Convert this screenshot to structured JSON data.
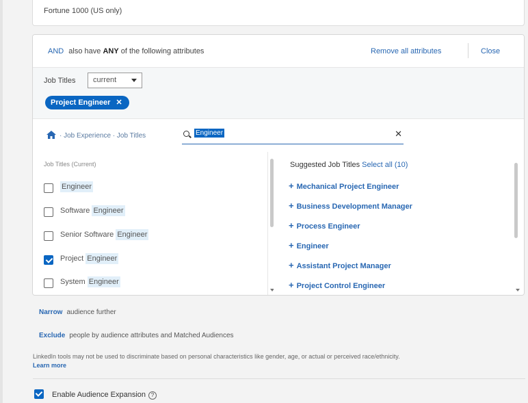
{
  "top_card": {
    "text": "Fortune 1000 (US only)"
  },
  "panel": {
    "and_prefix": "AND",
    "heading_pre": "also have",
    "heading_bold": "ANY",
    "heading_post": "of the following attributes",
    "remove_all": "Remove all attributes",
    "close": "Close",
    "job_titles_label": "Job Titles",
    "select_value": "current",
    "chip_label": "Project Engineer",
    "chip_x": "✕",
    "breadcrumb": "· Job Experience · Job Titles",
    "search_value": "Engineer",
    "clear_icon": "✕"
  },
  "left_list": {
    "header": "Job Titles (Current)",
    "items": [
      {
        "pre": "",
        "hl": "Engineer",
        "checked": false
      },
      {
        "pre": "Software ",
        "hl": "Engineer",
        "checked": false
      },
      {
        "pre": "Senior Software ",
        "hl": "Engineer",
        "checked": false
      },
      {
        "pre": "Project ",
        "hl": "Engineer",
        "checked": true
      },
      {
        "pre": "System ",
        "hl": "Engineer",
        "checked": false
      }
    ]
  },
  "right_list": {
    "header": "Suggested Job Titles",
    "select_all": "Select all (10)",
    "items": [
      "Mechanical Project Engineer",
      "Business Development Manager",
      "Process Engineer",
      "Engineer",
      "Assistant Project Manager",
      "Project Control Engineer"
    ]
  },
  "narrow": {
    "link": "Narrow",
    "text": "audience further"
  },
  "exclude": {
    "link": "Exclude",
    "text": "people by audience attributes and Matched Audiences"
  },
  "disclaimer": "LinkedIn tools may not be used to discriminate based on personal characteristics like gender, age, or actual or perceived race/ethnicity.",
  "learn_more": "Learn more",
  "expansion": {
    "label": "Enable Audience Expansion",
    "help": "?",
    "checked": true
  },
  "colors": {
    "accent": "#0a66c2",
    "link": "#2867b2"
  }
}
